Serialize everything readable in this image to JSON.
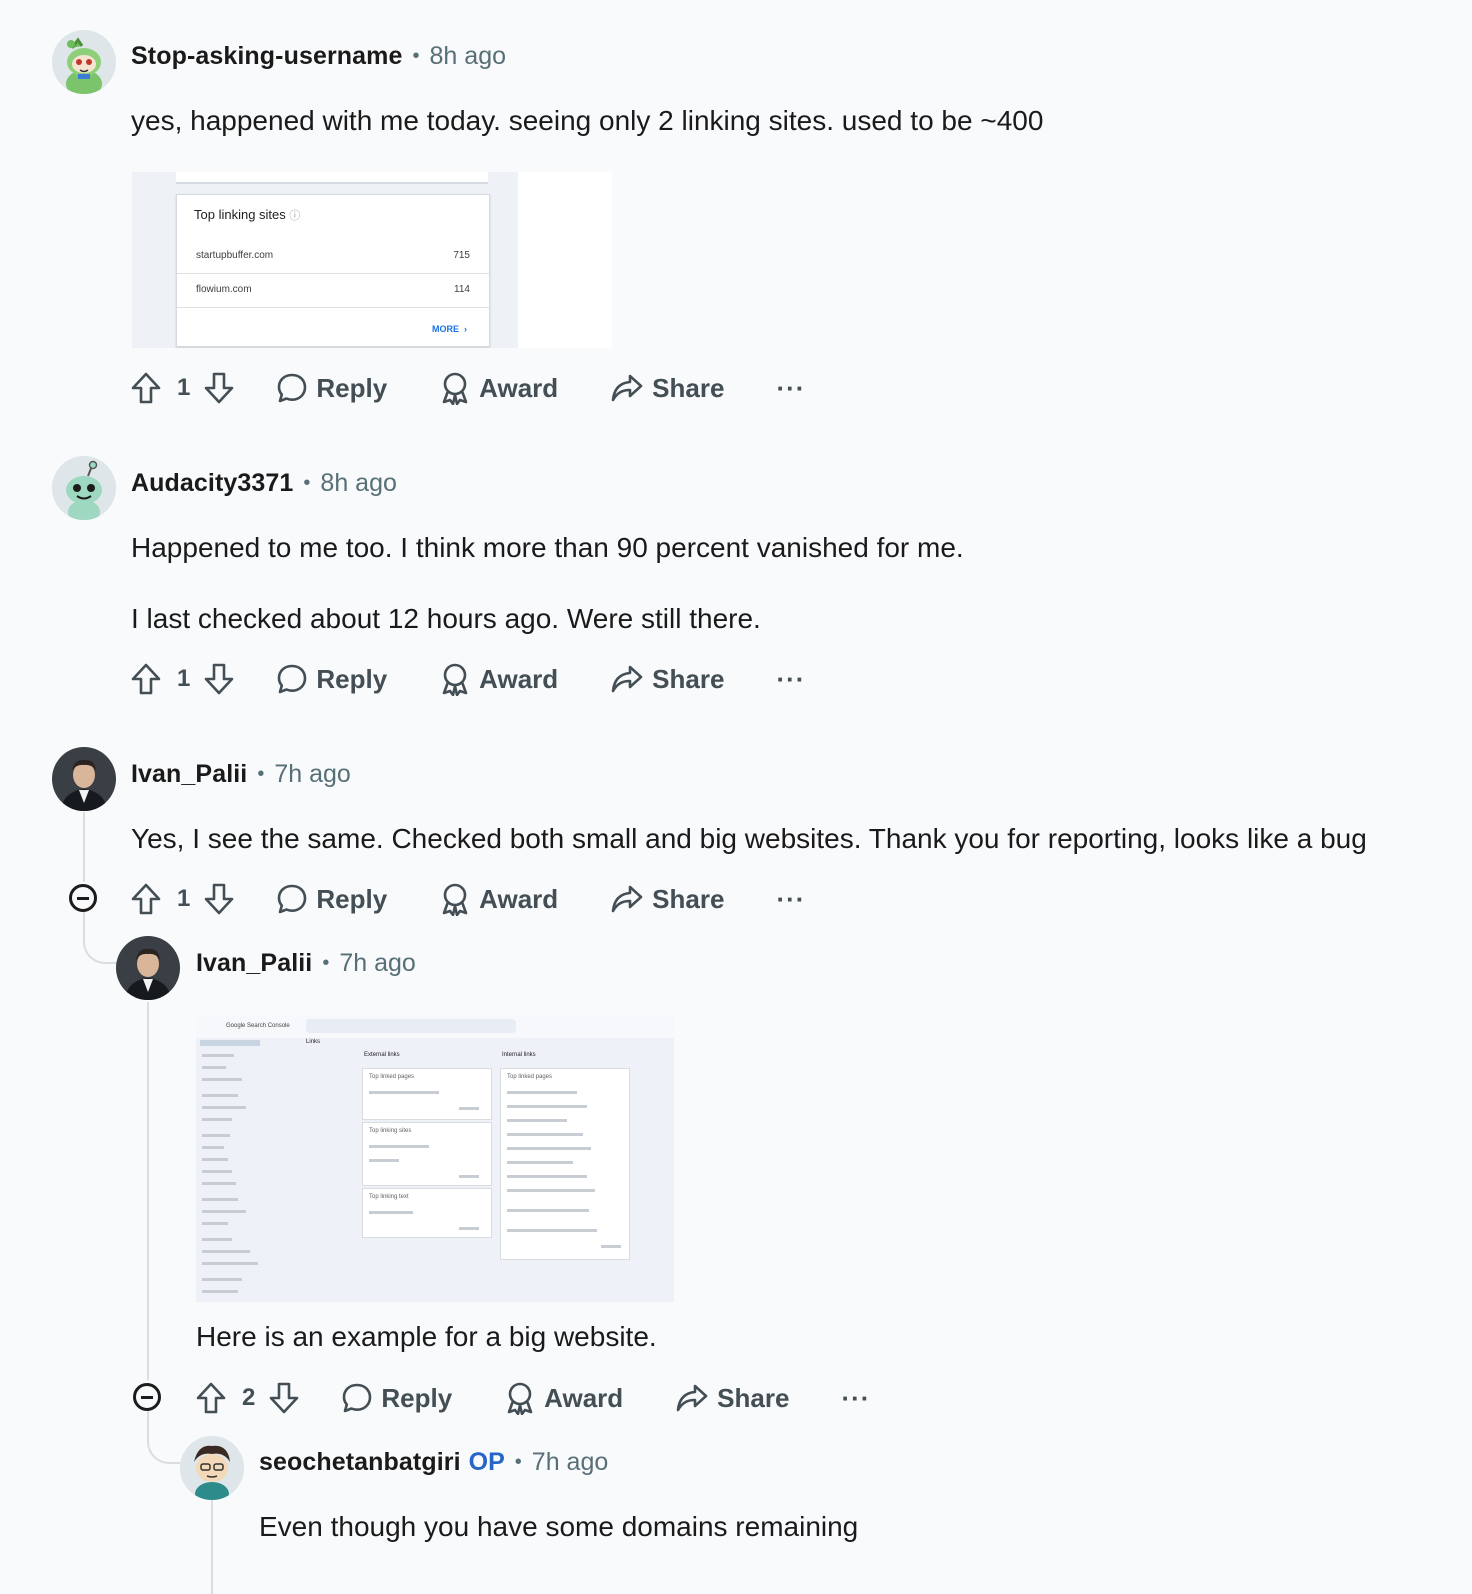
{
  "comments": [
    {
      "user": "Stop-asking-username",
      "time": "8h ago",
      "text": [
        "yes, happened with me today. seeing only 2 linking sites. used to be ~400"
      ],
      "votes": "1",
      "avatar_icon": "snoo-avatar-icon",
      "image": {
        "title": "Top linking sites",
        "rows": [
          {
            "site": "startupbuffer.com",
            "count": "715"
          },
          {
            "site": "flowium.com",
            "count": "114"
          }
        ],
        "more": "MORE"
      }
    },
    {
      "user": "Audacity3371",
      "time": "8h ago",
      "text": [
        "Happened to me too. I think more than 90 percent vanished for me.",
        "I last checked about 12 hours ago. Were still there."
      ],
      "votes": "1",
      "avatar_icon": "snoo-avatar-icon"
    },
    {
      "user": "Ivan_Palii",
      "time": "7h ago",
      "text": [
        "Yes, I see the same. Checked both small and big websites. Thank you for reporting, looks like a bug"
      ],
      "votes": "1",
      "avatar_icon": "profile-photo-avatar"
    },
    {
      "user": "Ivan_Palii",
      "time": "7h ago",
      "text": [
        "Here is an example for a big website."
      ],
      "votes": "2",
      "avatar_icon": "profile-photo-avatar",
      "image": {
        "app": "Google Search Console",
        "heading": "Links",
        "external": "External links",
        "internal": "Internal links",
        "top_linked": "Top linked pages",
        "top_linking_sites": "Top linking sites",
        "top_linking_text": "Top linking text"
      }
    },
    {
      "user": "seochetanbatgiri",
      "op": "OP",
      "time": "7h ago",
      "text": [
        "Even though you have some domains remaining"
      ],
      "avatar_icon": "snoo-avatar-icon"
    }
  ],
  "actions": {
    "reply": "Reply",
    "award": "Award",
    "share": "Share",
    "more": "···"
  },
  "separator": "•"
}
